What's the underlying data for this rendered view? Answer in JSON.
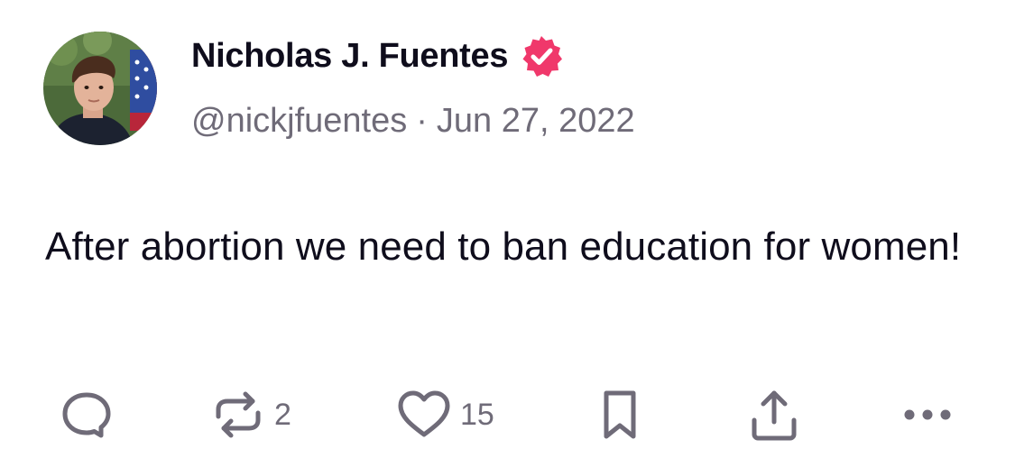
{
  "post": {
    "display_name": "Nicholas J. Fuentes",
    "handle": "@nickjfuentes",
    "separator": "·",
    "date": "Jun 27, 2022",
    "text": "After abortion we need to ban education for women!",
    "verified_badge_icon": "verified-badge-icon",
    "badge_color": "#f0386b"
  },
  "actions": {
    "reply": {
      "icon": "reply-icon",
      "count": ""
    },
    "repost": {
      "icon": "repost-icon",
      "count": "2"
    },
    "like": {
      "icon": "heart-icon",
      "count": "15"
    },
    "bookmark": {
      "icon": "bookmark-icon"
    },
    "share": {
      "icon": "share-icon"
    },
    "more": {
      "icon": "more-icon"
    }
  },
  "colors": {
    "text_primary": "#0f0d1c",
    "text_secondary": "#6f6b78",
    "icon": "#6f6b78"
  }
}
